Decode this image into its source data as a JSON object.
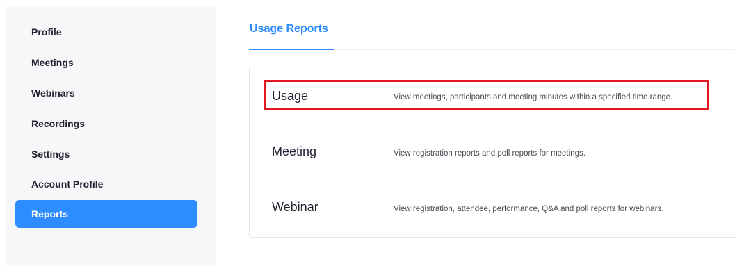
{
  "sidebar": {
    "items": [
      {
        "label": "Profile"
      },
      {
        "label": "Meetings"
      },
      {
        "label": "Webinars"
      },
      {
        "label": "Recordings"
      },
      {
        "label": "Settings"
      },
      {
        "label": "Account Profile"
      },
      {
        "label": "Reports",
        "active": true
      }
    ]
  },
  "tabs": [
    {
      "label": "Usage Reports",
      "active": true
    }
  ],
  "reports": [
    {
      "title": "Usage",
      "description": "View meetings, participants and meeting minutes within a specified time range."
    },
    {
      "title": "Meeting",
      "description": "View registration reports and poll reports for meetings."
    },
    {
      "title": "Webinar",
      "description": "View registration, attendee, performance, Q&A and poll reports for webinars."
    }
  ],
  "colors": {
    "accent": "#2d8cff",
    "highlight": "#e0171f",
    "sidebar_bg": "#f6f7f9"
  }
}
